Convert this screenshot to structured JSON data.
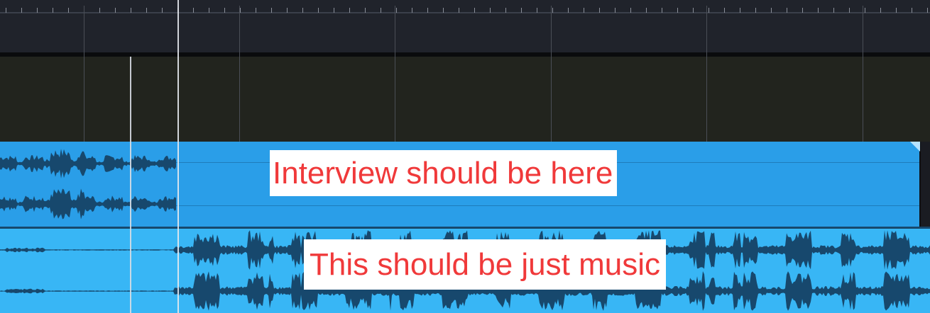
{
  "timeline": {
    "ruler": {
      "has_minor_ticks": true
    },
    "tracks": [
      {
        "name": "empty-track",
        "state": "empty"
      },
      {
        "name": "audio-track-1",
        "color": "#2a9ee8"
      },
      {
        "name": "audio-track-2",
        "color": "#38b6f5"
      }
    ]
  },
  "annotations": {
    "interview": "Interview should be here",
    "music": "This should be just music",
    "text_color": "#f0393a"
  },
  "colors": {
    "ruler_bg": "#20232b",
    "track_empty_bg": "#22241e",
    "track1_clip": "#2a9ee8",
    "track2_clip": "#38b6f5",
    "waveform": "#17486d"
  }
}
